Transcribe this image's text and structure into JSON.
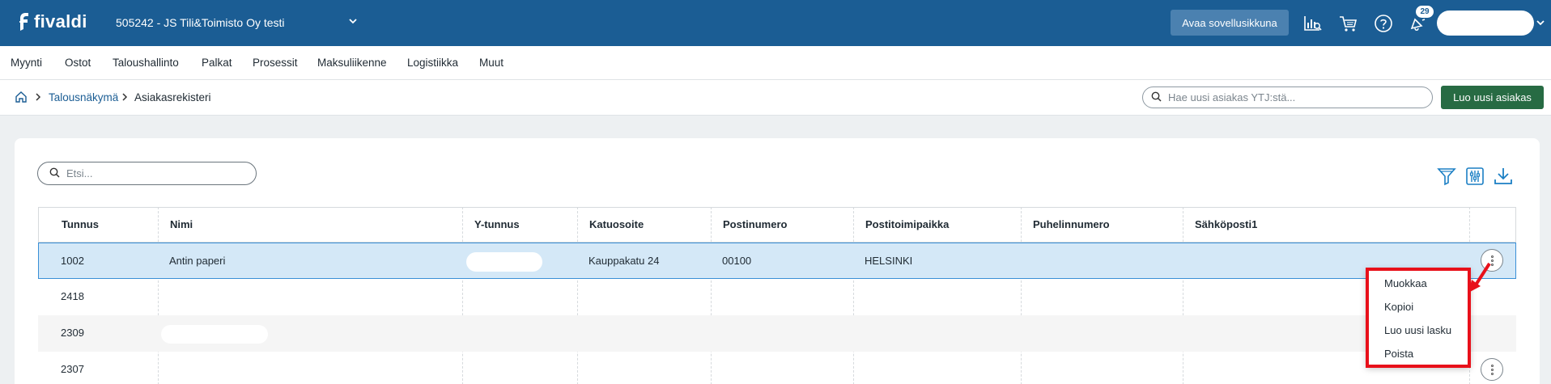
{
  "topbar": {
    "logo_text": "fivaldi",
    "company": "505242 - JS Tili&Toimisto Oy testi",
    "open_app_label": "Avaa sovellusikkuna",
    "notification_count": "29",
    "icons": [
      "analytics-icon",
      "cart-icon",
      "help-icon",
      "notification-icon",
      "chevron-down-icon"
    ]
  },
  "nav": {
    "items": [
      "Myynti",
      "Ostot",
      "Taloushallinto",
      "Palkat",
      "Prosessit",
      "Maksuliikenne",
      "Logistiikka",
      "Muut"
    ]
  },
  "breadcrumb": {
    "parent": "Talousnäkymä",
    "current": "Asiakasrekisteri"
  },
  "ytj_search": {
    "placeholder": "Hae uusi asiakas YTJ:stä..."
  },
  "new_customer_label": "Luo uusi asiakas",
  "list": {
    "search_placeholder": "Etsi...",
    "columns": [
      "Tunnus",
      "Nimi",
      "Y-tunnus",
      "Katuosoite",
      "Postinumero",
      "Postitoimipaikka",
      "Puhelinnumero",
      "Sähköposti1"
    ],
    "rows": [
      {
        "tunnus": "1002",
        "nimi": "Antin paperi",
        "ytunnus": "",
        "katuosoite": "Kauppakatu 24",
        "postinumero": "00100",
        "postitoimipaikka": "HELSINKI",
        "puhelin": "",
        "email": ""
      },
      {
        "tunnus": "2418",
        "nimi": "",
        "ytunnus": "",
        "katuosoite": "",
        "postinumero": "",
        "postitoimipaikka": "",
        "puhelin": "",
        "email": ""
      },
      {
        "tunnus": "2309",
        "nimi": "",
        "ytunnus": "",
        "katuosoite": "",
        "postinumero": "",
        "postitoimipaikka": "",
        "puhelin": "",
        "email": ""
      },
      {
        "tunnus": "2307",
        "nimi": "",
        "ytunnus": "",
        "katuosoite": "",
        "postinumero": "",
        "postitoimipaikka": "",
        "puhelin": "",
        "email": ""
      }
    ]
  },
  "context_menu": {
    "items": [
      "Muokkaa",
      "Kopioi",
      "Luo uusi lasku",
      "Poista"
    ]
  },
  "colors": {
    "topbar": "#1b5d94",
    "primary_button": "#276b43",
    "selected_row": "#d4e8f7",
    "highlight": "#e8101a"
  }
}
